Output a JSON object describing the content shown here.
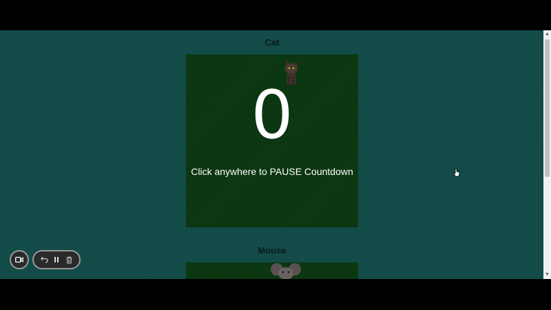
{
  "sections": [
    {
      "title": "Cat",
      "count": "0",
      "instruction": "Click anywhere to PAUSE Countdown",
      "image": "cat-image"
    },
    {
      "title": "Mouse",
      "image": "mouse-image"
    }
  ],
  "toolbar": {
    "record": "video-camera-icon",
    "undo": "undo-icon",
    "pause": "pause-icon",
    "delete": "trash-icon"
  },
  "colors": {
    "background": "#114a47",
    "card": "#0c3a12",
    "text": "#ffffff"
  }
}
